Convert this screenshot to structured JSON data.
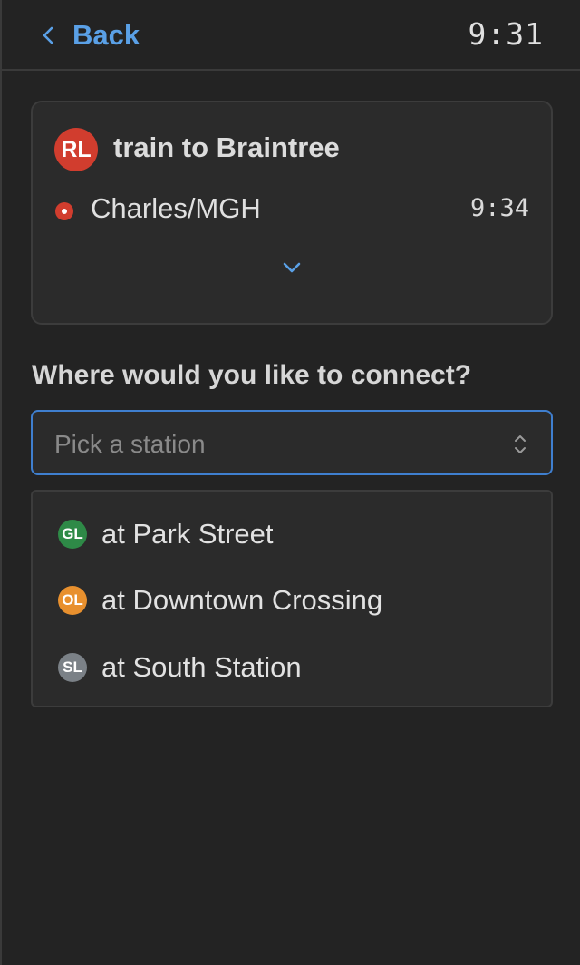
{
  "header": {
    "back_label": "Back",
    "clock": "9:31"
  },
  "trip": {
    "route_badge": "RL",
    "route_color": "#d13d2e",
    "title": "train to Braintree",
    "stop_name": "Charles/MGH",
    "stop_time": "9:34"
  },
  "connect": {
    "heading": "Where would you like to connect?",
    "select_placeholder": "Pick a station",
    "options": [
      {
        "badge": "GL",
        "color": "#2e8a47",
        "label": "at Park Street"
      },
      {
        "badge": "OL",
        "color": "#e8902e",
        "label": "at Downtown Crossing"
      },
      {
        "badge": "SL",
        "color": "#7b8187",
        "label": "at South Station"
      }
    ]
  },
  "icons": {
    "back": "chevron-left-icon",
    "expand": "chevron-down-icon",
    "select": "updown-chevron-icon"
  }
}
